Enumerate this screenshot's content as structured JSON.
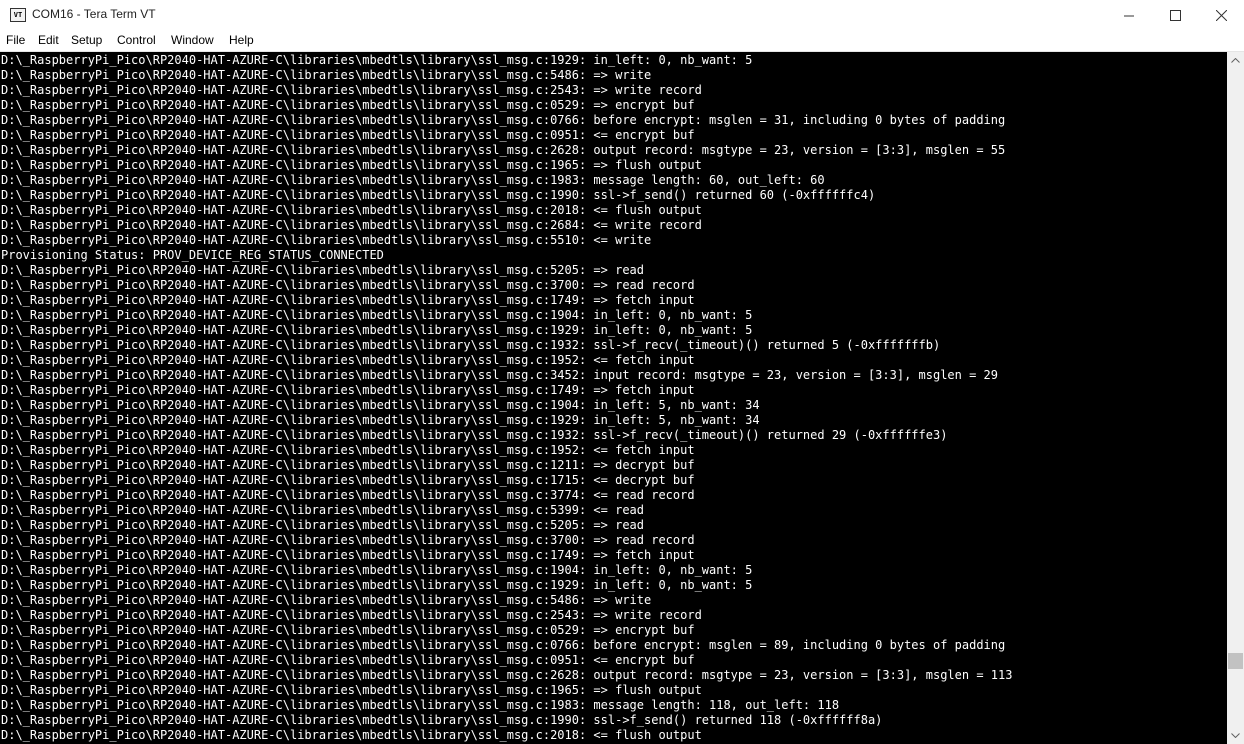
{
  "window": {
    "title": "COM16 - Tera Term VT",
    "icon_label": "VT"
  },
  "menu": [
    "File",
    "Edit",
    "Setup",
    "Control",
    "Window",
    "Help"
  ],
  "terminal": {
    "lines": [
      "D:\\_RaspberryPi_Pico\\RP2040-HAT-AZURE-C\\libraries\\mbedtls\\library\\ssl_msg.c:1929: in_left: 0, nb_want: 5",
      "D:\\_RaspberryPi_Pico\\RP2040-HAT-AZURE-C\\libraries\\mbedtls\\library\\ssl_msg.c:5486: => write",
      "D:\\_RaspberryPi_Pico\\RP2040-HAT-AZURE-C\\libraries\\mbedtls\\library\\ssl_msg.c:2543: => write record",
      "D:\\_RaspberryPi_Pico\\RP2040-HAT-AZURE-C\\libraries\\mbedtls\\library\\ssl_msg.c:0529: => encrypt buf",
      "D:\\_RaspberryPi_Pico\\RP2040-HAT-AZURE-C\\libraries\\mbedtls\\library\\ssl_msg.c:0766: before encrypt: msglen = 31, including 0 bytes of padding",
      "D:\\_RaspberryPi_Pico\\RP2040-HAT-AZURE-C\\libraries\\mbedtls\\library\\ssl_msg.c:0951: <= encrypt buf",
      "D:\\_RaspberryPi_Pico\\RP2040-HAT-AZURE-C\\libraries\\mbedtls\\library\\ssl_msg.c:2628: output record: msgtype = 23, version = [3:3], msglen = 55",
      "D:\\_RaspberryPi_Pico\\RP2040-HAT-AZURE-C\\libraries\\mbedtls\\library\\ssl_msg.c:1965: => flush output",
      "D:\\_RaspberryPi_Pico\\RP2040-HAT-AZURE-C\\libraries\\mbedtls\\library\\ssl_msg.c:1983: message length: 60, out_left: 60",
      "D:\\_RaspberryPi_Pico\\RP2040-HAT-AZURE-C\\libraries\\mbedtls\\library\\ssl_msg.c:1990: ssl->f_send() returned 60 (-0xffffffc4)",
      "D:\\_RaspberryPi_Pico\\RP2040-HAT-AZURE-C\\libraries\\mbedtls\\library\\ssl_msg.c:2018: <= flush output",
      "D:\\_RaspberryPi_Pico\\RP2040-HAT-AZURE-C\\libraries\\mbedtls\\library\\ssl_msg.c:2684: <= write record",
      "D:\\_RaspberryPi_Pico\\RP2040-HAT-AZURE-C\\libraries\\mbedtls\\library\\ssl_msg.c:5510: <= write",
      "Provisioning Status: PROV_DEVICE_REG_STATUS_CONNECTED",
      "D:\\_RaspberryPi_Pico\\RP2040-HAT-AZURE-C\\libraries\\mbedtls\\library\\ssl_msg.c:5205: => read",
      "D:\\_RaspberryPi_Pico\\RP2040-HAT-AZURE-C\\libraries\\mbedtls\\library\\ssl_msg.c:3700: => read record",
      "D:\\_RaspberryPi_Pico\\RP2040-HAT-AZURE-C\\libraries\\mbedtls\\library\\ssl_msg.c:1749: => fetch input",
      "D:\\_RaspberryPi_Pico\\RP2040-HAT-AZURE-C\\libraries\\mbedtls\\library\\ssl_msg.c:1904: in_left: 0, nb_want: 5",
      "D:\\_RaspberryPi_Pico\\RP2040-HAT-AZURE-C\\libraries\\mbedtls\\library\\ssl_msg.c:1929: in_left: 0, nb_want: 5",
      "D:\\_RaspberryPi_Pico\\RP2040-HAT-AZURE-C\\libraries\\mbedtls\\library\\ssl_msg.c:1932: ssl->f_recv(_timeout)() returned 5 (-0xfffffffb)",
      "D:\\_RaspberryPi_Pico\\RP2040-HAT-AZURE-C\\libraries\\mbedtls\\library\\ssl_msg.c:1952: <= fetch input",
      "D:\\_RaspberryPi_Pico\\RP2040-HAT-AZURE-C\\libraries\\mbedtls\\library\\ssl_msg.c:3452: input record: msgtype = 23, version = [3:3], msglen = 29",
      "D:\\_RaspberryPi_Pico\\RP2040-HAT-AZURE-C\\libraries\\mbedtls\\library\\ssl_msg.c:1749: => fetch input",
      "D:\\_RaspberryPi_Pico\\RP2040-HAT-AZURE-C\\libraries\\mbedtls\\library\\ssl_msg.c:1904: in_left: 5, nb_want: 34",
      "D:\\_RaspberryPi_Pico\\RP2040-HAT-AZURE-C\\libraries\\mbedtls\\library\\ssl_msg.c:1929: in_left: 5, nb_want: 34",
      "D:\\_RaspberryPi_Pico\\RP2040-HAT-AZURE-C\\libraries\\mbedtls\\library\\ssl_msg.c:1932: ssl->f_recv(_timeout)() returned 29 (-0xffffffe3)",
      "D:\\_RaspberryPi_Pico\\RP2040-HAT-AZURE-C\\libraries\\mbedtls\\library\\ssl_msg.c:1952: <= fetch input",
      "D:\\_RaspberryPi_Pico\\RP2040-HAT-AZURE-C\\libraries\\mbedtls\\library\\ssl_msg.c:1211: => decrypt buf",
      "D:\\_RaspberryPi_Pico\\RP2040-HAT-AZURE-C\\libraries\\mbedtls\\library\\ssl_msg.c:1715: <= decrypt buf",
      "D:\\_RaspberryPi_Pico\\RP2040-HAT-AZURE-C\\libraries\\mbedtls\\library\\ssl_msg.c:3774: <= read record",
      "D:\\_RaspberryPi_Pico\\RP2040-HAT-AZURE-C\\libraries\\mbedtls\\library\\ssl_msg.c:5399: <= read",
      "D:\\_RaspberryPi_Pico\\RP2040-HAT-AZURE-C\\libraries\\mbedtls\\library\\ssl_msg.c:5205: => read",
      "D:\\_RaspberryPi_Pico\\RP2040-HAT-AZURE-C\\libraries\\mbedtls\\library\\ssl_msg.c:3700: => read record",
      "D:\\_RaspberryPi_Pico\\RP2040-HAT-AZURE-C\\libraries\\mbedtls\\library\\ssl_msg.c:1749: => fetch input",
      "D:\\_RaspberryPi_Pico\\RP2040-HAT-AZURE-C\\libraries\\mbedtls\\library\\ssl_msg.c:1904: in_left: 0, nb_want: 5",
      "D:\\_RaspberryPi_Pico\\RP2040-HAT-AZURE-C\\libraries\\mbedtls\\library\\ssl_msg.c:1929: in_left: 0, nb_want: 5",
      "D:\\_RaspberryPi_Pico\\RP2040-HAT-AZURE-C\\libraries\\mbedtls\\library\\ssl_msg.c:5486: => write",
      "D:\\_RaspberryPi_Pico\\RP2040-HAT-AZURE-C\\libraries\\mbedtls\\library\\ssl_msg.c:2543: => write record",
      "D:\\_RaspberryPi_Pico\\RP2040-HAT-AZURE-C\\libraries\\mbedtls\\library\\ssl_msg.c:0529: => encrypt buf",
      "D:\\_RaspberryPi_Pico\\RP2040-HAT-AZURE-C\\libraries\\mbedtls\\library\\ssl_msg.c:0766: before encrypt: msglen = 89, including 0 bytes of padding",
      "D:\\_RaspberryPi_Pico\\RP2040-HAT-AZURE-C\\libraries\\mbedtls\\library\\ssl_msg.c:0951: <= encrypt buf",
      "D:\\_RaspberryPi_Pico\\RP2040-HAT-AZURE-C\\libraries\\mbedtls\\library\\ssl_msg.c:2628: output record: msgtype = 23, version = [3:3], msglen = 113",
      "D:\\_RaspberryPi_Pico\\RP2040-HAT-AZURE-C\\libraries\\mbedtls\\library\\ssl_msg.c:1965: => flush output",
      "D:\\_RaspberryPi_Pico\\RP2040-HAT-AZURE-C\\libraries\\mbedtls\\library\\ssl_msg.c:1983: message length: 118, out_left: 118",
      "D:\\_RaspberryPi_Pico\\RP2040-HAT-AZURE-C\\libraries\\mbedtls\\library\\ssl_msg.c:1990: ssl->f_send() returned 118 (-0xffffff8a)",
      "D:\\_RaspberryPi_Pico\\RP2040-HAT-AZURE-C\\libraries\\mbedtls\\library\\ssl_msg.c:2018: <= flush output"
    ],
    "foreground": "#ffffff",
    "background": "#000000"
  },
  "scrollbar": {
    "position": 0.91
  }
}
